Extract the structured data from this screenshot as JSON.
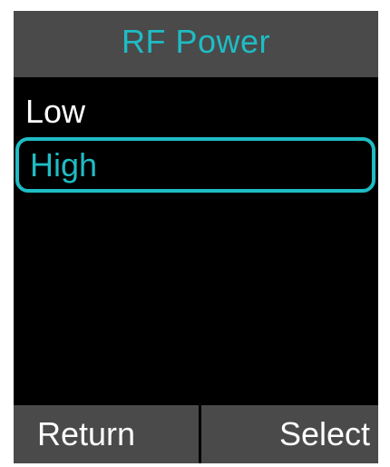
{
  "header": {
    "title": "RF Power"
  },
  "menu": {
    "items": [
      {
        "label": "Low",
        "selected": false
      },
      {
        "label": "High",
        "selected": true
      }
    ]
  },
  "softkeys": {
    "left_label": "Return",
    "right_label": "Select"
  },
  "colors": {
    "accent": "#1fbcc4",
    "bar_background": "#4a4a4a",
    "screen_background": "#000000",
    "text": "#ffffff"
  }
}
